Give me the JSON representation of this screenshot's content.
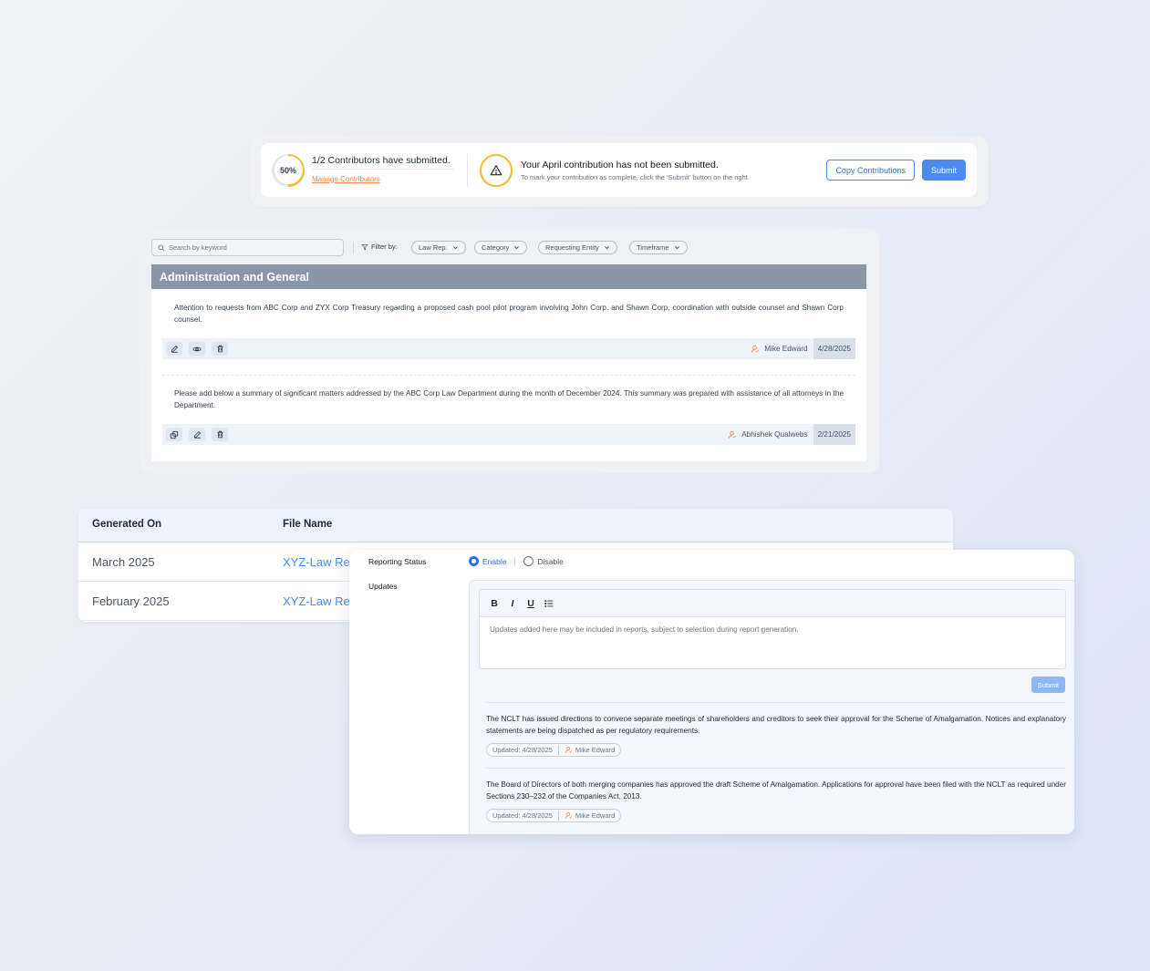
{
  "contributions": {
    "progress_label": "50%",
    "progress_fraction": 0.5,
    "submitted_text": "1/2 Contributors have submitted.",
    "manage_link": "Manage Contributors",
    "warning_title": "Your April contribution has not been submitted.",
    "warning_subtitle": "To mark your contribution as complete, click the 'Submit' button on the right.",
    "copy_button": "Copy Contributions",
    "submit_button": "Submit"
  },
  "search": {
    "placeholder": "Search by keyword"
  },
  "filters": {
    "label": "Filter by:",
    "chips": [
      "Law Rep.",
      "Category",
      "Requesting Entity",
      "Timeframe"
    ]
  },
  "section": {
    "title": "Administration and General",
    "entries": [
      {
        "text": "Attention to requests from ABC Corp and ZYX Corp Treasury regarding a proposed cash pool pilot program involving John Corp. and Shawn Corp, coordination with outside counsel and Shawn Corp counsel.",
        "author": "Mike Edward",
        "date": "4/28/2025"
      },
      {
        "text": "Please add below a summary of significant matters addressed by the ABC Corp Law Department during the month of December 2024. This summary was prepared with assistance of all attorneys in the Department.",
        "author": "Abhishek Qualwebs",
        "date": "2/21/2025"
      }
    ]
  },
  "reports_table": {
    "headers": [
      "Generated On",
      "File Name"
    ],
    "rows": [
      {
        "generated_on": "March 2025",
        "file_name": "XYZ-Law Re"
      },
      {
        "generated_on": "February 2025",
        "file_name": "XYZ-Law Re"
      }
    ]
  },
  "updates_panel": {
    "status_label": "Reporting Status",
    "enable_label": "Enable",
    "disable_label": "Disable",
    "updates_label": "Updates",
    "editor_tools": [
      "B",
      "I",
      "U"
    ],
    "editor_placeholder": "Updates added here may be included in reports, subject to selection during report generation.",
    "submit_button": "Submit",
    "items": [
      {
        "text": "The NCLT has issued directions to convene separate meetings of shareholders and creditors to seek their approval for the Scheme of Amalgamation. Notices and explanatory statements are being dispatched as per regulatory requirements.",
        "updated": "Updated: 4/28/2025",
        "author": "Mike Edward"
      },
      {
        "text": "The Board of Directors of both merging companies has approved the draft Scheme of Amalgamation. Applications for approval have been filed with the NCLT as required under Sections 230–232 of the Companies Act, 2013.",
        "updated": "Updated: 4/28/2025",
        "author": "Mike Edward"
      }
    ]
  },
  "colors": {
    "accent": "#4b8bf0",
    "warning": "#f5b82e",
    "author_icon": "#f08a4b",
    "section_header": "#8a96a8"
  }
}
